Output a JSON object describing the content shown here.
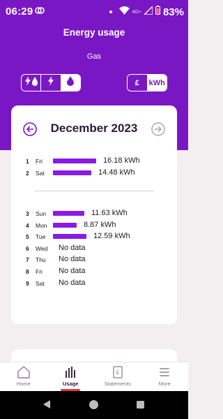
{
  "status_bar": {
    "time": "06:29",
    "battery": "83%",
    "network": "4G+"
  },
  "header": {
    "title": "Energy usage",
    "subtitle": "Gas"
  },
  "fuel_toggle": {
    "options": [
      {
        "icon": "electricity-gas-icon",
        "active": false
      },
      {
        "icon": "electricity-icon",
        "active": false
      },
      {
        "icon": "gas-flame-icon",
        "active": true
      }
    ]
  },
  "unit_toggle": {
    "pound_label": "£",
    "kwh_label": "kWh",
    "selected": "kWh"
  },
  "month": {
    "title": "December 2023"
  },
  "colors": {
    "brand": "#7a17c4",
    "bar": "#8a1be6",
    "indicator": "#e23b3b"
  },
  "week1": [
    {
      "num": "1",
      "day": "Fri",
      "value": "16.18 kWh",
      "kwh": 16.18
    },
    {
      "num": "2",
      "day": "Sat",
      "value": "14.48 kWh",
      "kwh": 14.48
    }
  ],
  "week2": [
    {
      "num": "3",
      "day": "Sun",
      "value": "11.63 kWh",
      "kwh": 11.63
    },
    {
      "num": "4",
      "day": "Mon",
      "value": "8.87 kWh",
      "kwh": 8.87
    },
    {
      "num": "5",
      "day": "Tue",
      "value": "12.59 kWh",
      "kwh": 12.59
    },
    {
      "num": "6",
      "day": "Wed",
      "value": "No data",
      "kwh": null
    },
    {
      "num": "7",
      "day": "Thu",
      "value": "No data",
      "kwh": null
    },
    {
      "num": "8",
      "day": "Fri",
      "value": "No data",
      "kwh": null
    },
    {
      "num": "9",
      "day": "Sat",
      "value": "No data",
      "kwh": null
    }
  ],
  "bottom_nav": {
    "items": [
      {
        "label": "Home",
        "icon": "home-icon",
        "active": false
      },
      {
        "label": "Usage",
        "icon": "bar-chart-icon",
        "active": true
      },
      {
        "label": "Statements",
        "icon": "statement-icon",
        "active": false
      },
      {
        "label": "More",
        "icon": "menu-icon",
        "active": false
      }
    ]
  }
}
